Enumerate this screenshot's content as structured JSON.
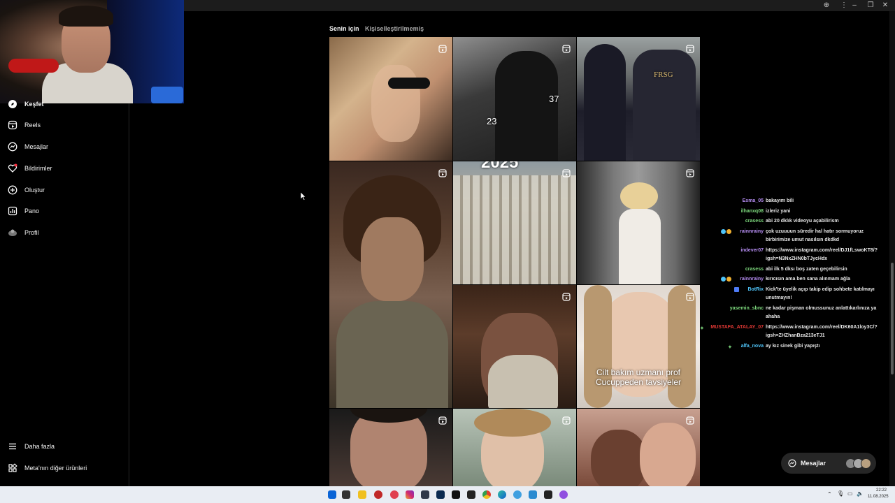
{
  "window": {
    "zoom_icon": "zoom-icon",
    "min_icon": "minimize-icon",
    "max_icon": "maximize-icon",
    "close_icon": "close-icon"
  },
  "sidebar": {
    "items": [
      {
        "label": "Keşfet",
        "icon": "compass-icon"
      },
      {
        "label": "Reels",
        "icon": "reels-icon"
      },
      {
        "label": "Mesajlar",
        "icon": "messenger-icon"
      },
      {
        "label": "Bildirimler",
        "icon": "heart-icon"
      },
      {
        "label": "Oluştur",
        "icon": "plus-square-icon"
      },
      {
        "label": "Pano",
        "icon": "dashboard-icon"
      },
      {
        "label": "Profil",
        "icon": "avatar-icon"
      }
    ],
    "more_label": "Daha fazla",
    "meta_label": "Meta'nın diğer ürünleri"
  },
  "feed_tabs": {
    "active": "Senin için",
    "inactive": "Kişiselleştirilmemiş"
  },
  "grid": {
    "tile_captions": {
      "t2_left": "23",
      "t2_right": "37",
      "t3_logo": "FRSG",
      "t5_top": "2025",
      "t9": "Cilt bakım uzmanı prof Cucuppeden tavsiyeler"
    }
  },
  "chat": {
    "messages": [
      {
        "user": "Esma_05",
        "color": "#b48cf0",
        "text": "bakayım bili"
      },
      {
        "user": "ilhanxq08",
        "color": "#7dd87d",
        "text": "izleriz yani"
      },
      {
        "user": "crasess",
        "color": "#7dd87d",
        "text": "abi 20 dklık videoyu açabilirism"
      },
      {
        "user": "rainnrainy",
        "color": "#b48cf0",
        "text": "çok uzuuuun süredir hal hatır sormuyoruz birbirimize umut nasılsın dkdkd"
      },
      {
        "user": "indever07",
        "color": "#b48cf0",
        "text": "https://www.instagram.com/reel/DJ1fLswoKT8/?igsh=N3NxZHN0bTJycHdx"
      },
      {
        "user": "crasess",
        "color": "#7dd87d",
        "text": "abi ilk 5 dksı boş zaten geçebilirsin"
      },
      {
        "user": "rainnrainy",
        "color": "#b48cf0",
        "text": "kırıcısın ama ben sana alınmam ağla"
      },
      {
        "user": "BotRix",
        "color": "#4fc3f7",
        "text": "Kick'te üyelik açıp takip edip sohbete katılmayı unutmayın!"
      },
      {
        "user": "yasemin_sbnc",
        "color": "#7dd87d",
        "text": "ne kadar pişman olmussunuz anlattıkarlınıza ya ahaha"
      },
      {
        "user": "MUSTAFA_ATALAY_07",
        "color": "#e53935",
        "text": "https://www.instagram.com/reel/DK60A1loy3C/?igsh=ZHZhanBza213eTJ1"
      },
      {
        "user": "alfa_nova",
        "color": "#4fc3f7",
        "text": "ay kız sinek gibi yapıştı"
      }
    ]
  },
  "messages_button": {
    "label": "Mesajlar"
  },
  "taskbar": {
    "time": "22:22",
    "date": "11.08.2025"
  },
  "colors": {
    "bg": "#000000",
    "sidebar_border": "#262626",
    "muted": "#a8a8a8"
  }
}
